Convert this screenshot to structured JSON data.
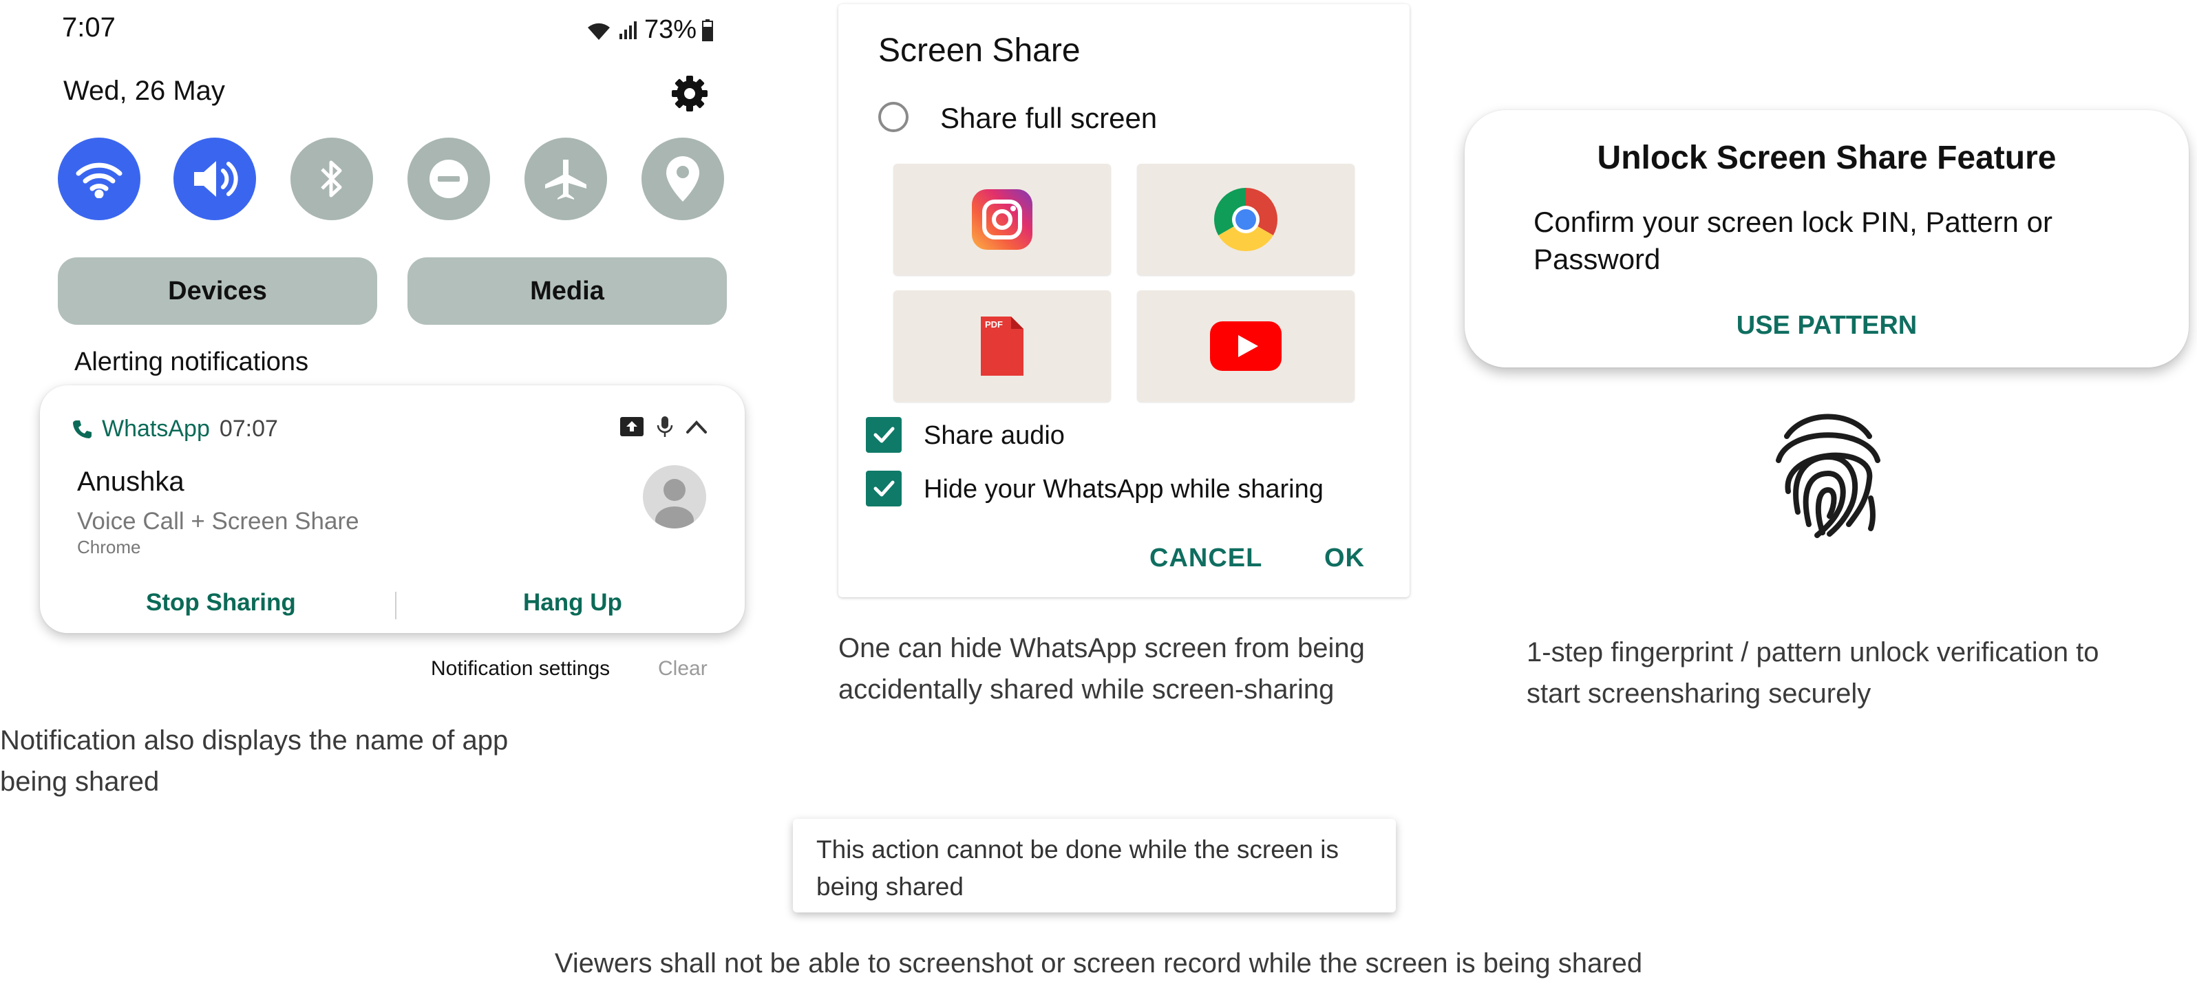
{
  "status_bar": {
    "time": "7:07",
    "battery": "73%"
  },
  "quick_settings": {
    "date": "Wed, 26 May",
    "tiles": [
      {
        "name": "wifi",
        "state": "on"
      },
      {
        "name": "sound",
        "state": "on"
      },
      {
        "name": "bluetooth",
        "state": "off"
      },
      {
        "name": "do-not-disturb",
        "state": "off"
      },
      {
        "name": "airplane-mode",
        "state": "off"
      },
      {
        "name": "location",
        "state": "off"
      }
    ],
    "devices_label": "Devices",
    "media_label": "Media",
    "alerting_label": "Alerting notifications"
  },
  "notification": {
    "app": "WhatsApp",
    "time": "07:07",
    "title": "Anushka",
    "body": "Voice Call + Screen Share",
    "shared_app": "Chrome",
    "stop_label": "Stop Sharing",
    "hangup_label": "Hang Up",
    "settings_label": "Notification settings",
    "clear_label": "Clear"
  },
  "captions": {
    "notification": "Notification also displays the name of app being shared",
    "dialog": "One can hide WhatsApp screen from being accidentally shared while screen-sharing",
    "unlock": "1-step fingerprint / pattern unlock verification to start screensharing securely",
    "footer": "Viewers shall not be able to screenshot or screen record while the screen is being shared"
  },
  "share_dialog": {
    "title": "Screen Share",
    "full_screen_label": "Share full screen",
    "full_screen_checked": false,
    "apps": [
      "instagram-icon",
      "chrome-icon",
      "pdf-icon",
      "youtube-icon"
    ],
    "pdf_badge": "PDF",
    "share_audio_label": "Share audio",
    "share_audio_checked": true,
    "hide_whatsapp_label": "Hide your WhatsApp while sharing",
    "hide_whatsapp_checked": true,
    "cancel_label": "CANCEL",
    "ok_label": "OK"
  },
  "toast": {
    "text": "This action cannot be done while the screen is being shared"
  },
  "unlock": {
    "title": "Unlock Screen Share Feature",
    "body": "Confirm your screen lock PIN, Pattern or Password",
    "button_label": "USE PATTERN"
  },
  "colors": {
    "accent_blue": "#3a66ef",
    "tile_off": "#a9b6b2",
    "whatsapp_green": "#0f6e60",
    "checkbox": "#0f7a68"
  }
}
